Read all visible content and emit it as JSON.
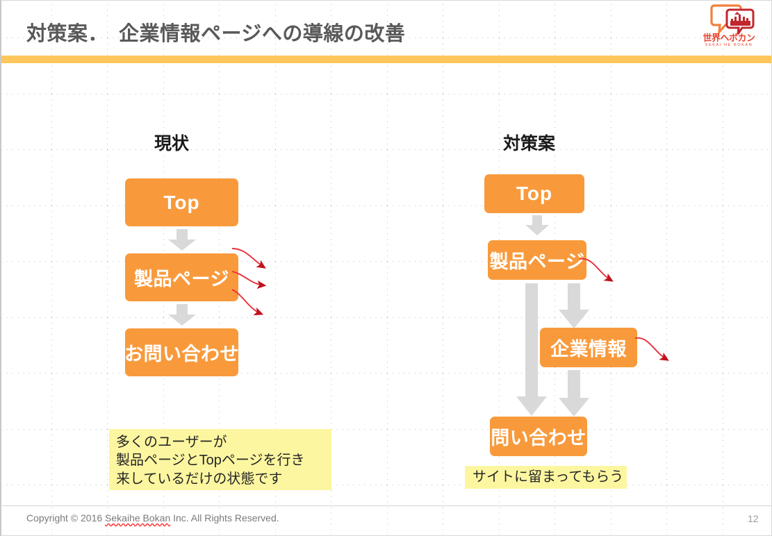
{
  "slide": {
    "title": "対策案．　企業情報ページへの導線の改善",
    "accent_bar_color": "#FFC75B",
    "node_color": "#F89A3C",
    "note_color": "#FCF6A0",
    "arrow_gray": "#D9D9D9",
    "arrow_red": "#E02020"
  },
  "logo": {
    "wordmark": "世界ヘボカン",
    "romaji": "SEKAI HE BOKAN",
    "icon_name": "speech-bubble-logo"
  },
  "columns": {
    "current": {
      "heading": "現状",
      "nodes": [
        {
          "label": "Top",
          "script": "latin"
        },
        {
          "label": "製品ページ",
          "script": "jp"
        },
        {
          "label": "お問い合わせ",
          "script": "jp"
        }
      ],
      "exit_arrow_count": 3
    },
    "proposal": {
      "heading": "対策案",
      "nodes": [
        {
          "label": "Top",
          "script": "latin"
        },
        {
          "label": "製品ページ",
          "script": "jp"
        },
        {
          "label": "企業情報",
          "script": "jp"
        },
        {
          "label": "問い合わせ",
          "script": "jp"
        }
      ],
      "exit_arrow_count": 2
    }
  },
  "notes": {
    "left": {
      "lines": [
        "多くのユーザーが",
        "製品ページとTopページを行き",
        "来しているだけの状態です"
      ]
    },
    "right": {
      "lines": [
        "サイトに留まってもらう"
      ]
    }
  },
  "footer": {
    "copyright_prefix": "Copyright © 2016 ",
    "copyright_company": "Sekaihe Bokan",
    "copyright_suffix": " Inc. All Rights Reserved.",
    "page_number": "12"
  }
}
